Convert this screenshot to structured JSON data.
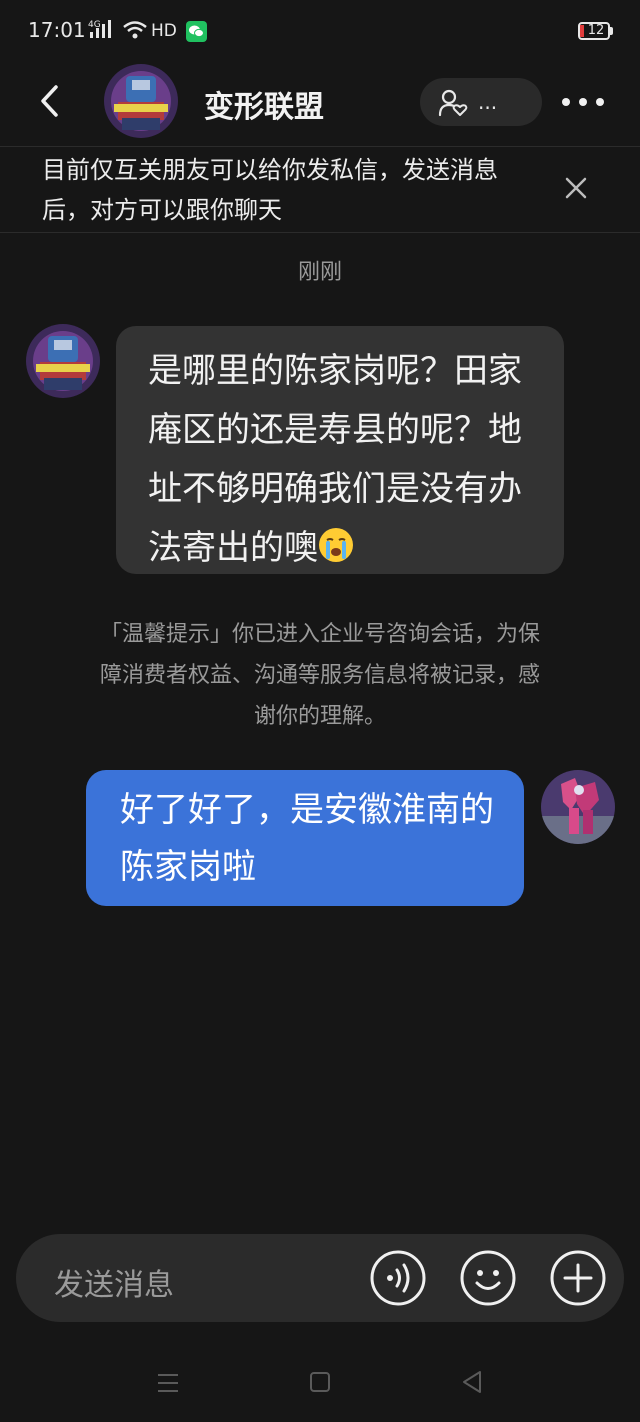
{
  "status": {
    "time": "17:01",
    "network": "4G",
    "hd": "HD",
    "battery": "12"
  },
  "header": {
    "title": "变形联盟",
    "follow_dots": "..."
  },
  "notice": {
    "text": "目前仅互关朋友可以给你发私信，发送消息后，对方可以跟你聊天"
  },
  "chat": {
    "timestamp": "刚刚",
    "incoming_message": "是哪里的陈家岗呢？田家庵区的还是寿县的呢？地址不够明确我们是没有办法寄出的噢",
    "incoming_emoji": "crying-face-emoji",
    "system_message": "「温馨提示」你已进入企业号咨询会话，为保障消费者权益、沟通等服务信息将被记录，感谢你的理解。",
    "outgoing_message": "好了好了，是安徽淮南的陈家岗啦"
  },
  "input": {
    "placeholder": "发送消息"
  },
  "icons": {
    "back": "back-chevron-icon",
    "follow": "person-heart-icon",
    "more": "more-dots-icon",
    "close": "close-icon",
    "voice": "voice-icon",
    "emoji": "emoji-icon",
    "plus": "plus-icon"
  },
  "colors": {
    "background": "#161616",
    "incoming_bubble": "#333333",
    "outgoing_bubble": "#3b73d9",
    "input_bar": "#2b2b2b"
  }
}
